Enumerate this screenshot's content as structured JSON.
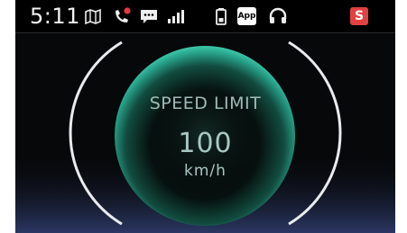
{
  "status_bar": {
    "time": "5:11",
    "icons": [
      "map-icon",
      "phone-missed-call-icon",
      "message-icon",
      "signal-icon",
      "battery-icon",
      "app-icon",
      "headset-icon",
      "s-icon"
    ],
    "app_label": "App",
    "s_label": "S"
  },
  "speed_limit": {
    "title": "SPEED LIMIT",
    "value": "100",
    "unit": "km/h"
  },
  "colors": {
    "background": "#07080a",
    "gauge_fill": "#2aa98e",
    "gauge_ring": "#ffffff",
    "status_red": "#e24141"
  }
}
